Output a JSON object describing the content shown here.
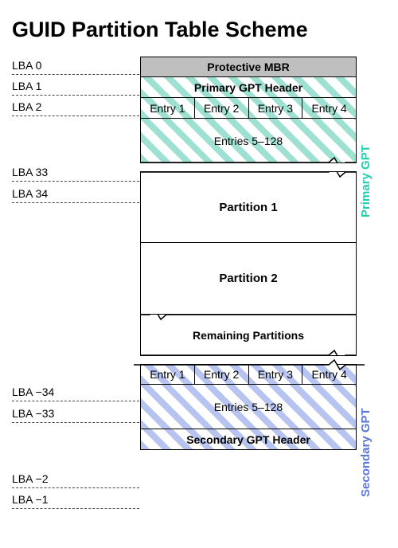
{
  "title": "GUID Partition Table Scheme",
  "lba": {
    "l0": "LBA 0",
    "l1": "LBA 1",
    "l2": "LBA 2",
    "l33": "LBA 33",
    "l34": "LBA 34",
    "ln34": "LBA −34",
    "ln33": "LBA −33",
    "ln2": "LBA −2",
    "ln1": "LBA −1"
  },
  "blocks": {
    "mbr": "Protective MBR",
    "primary_header": "Primary GPT Header",
    "secondary_header": "Secondary GPT Header",
    "entry1": "Entry 1",
    "entry2": "Entry 2",
    "entry3": "Entry 3",
    "entry4": "Entry 4",
    "entries_rest": "Entries 5–128",
    "partition1": "Partition 1",
    "partition2": "Partition 2",
    "remaining": "Remaining Partitions"
  },
  "side": {
    "primary": "Primary GPT",
    "secondary": "Secondary GPT"
  },
  "colors": {
    "teal": "#1ecfb0",
    "blue": "#5976d8",
    "gray": "#bfbfbf"
  }
}
